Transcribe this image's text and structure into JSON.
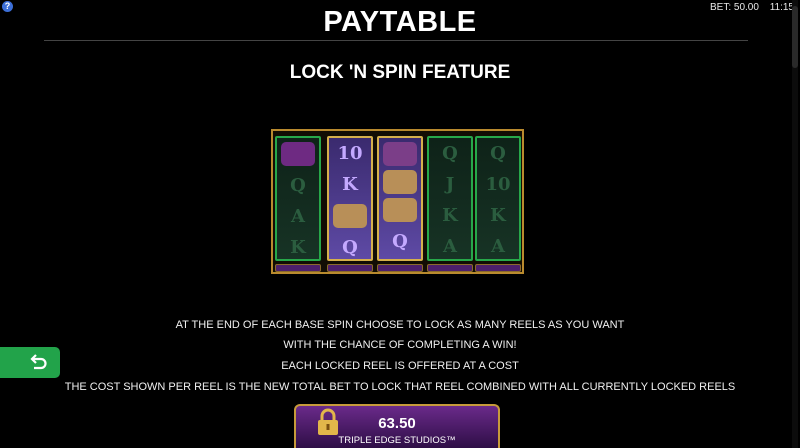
{
  "status": {
    "bet": "BET: 50.00",
    "time": "11:15"
  },
  "help_label": "?",
  "header": {
    "title": "PAYTABLE",
    "subtitle": "LOCK 'N SPIN FEATURE"
  },
  "reels": [
    {
      "state": "dim",
      "symbols": [
        "",
        "Q",
        "A",
        "K"
      ]
    },
    {
      "state": "locked",
      "symbols": [
        "10",
        "K",
        "",
        "Q"
      ]
    },
    {
      "state": "locked",
      "symbols": [
        "",
        "",
        "",
        "Q"
      ]
    },
    {
      "state": "dim",
      "symbols": [
        "Q",
        "J",
        "K",
        "A"
      ]
    },
    {
      "state": "dim",
      "symbols": [
        "Q",
        "10",
        "K",
        "A"
      ]
    }
  ],
  "description": [
    "AT THE END OF EACH BASE SPIN CHOOSE TO LOCK AS MANY REELS AS YOU WANT",
    "WITH THE CHANCE OF COMPLETING A WIN!",
    "EACH LOCKED REEL IS OFFERED AT A COST",
    "THE COST SHOWN PER REEL IS THE NEW TOTAL BET TO LOCK THAT REEL COMBINED WITH ALL CURRENTLY LOCKED REELS"
  ],
  "cost_panel": {
    "value": "63.50",
    "studio": "TRIPLE EDGE STUDIOS™"
  },
  "colors": {
    "back_button": "#22a34a",
    "reel_border_active": "#27a84a",
    "frame_gold": "#b98a2e"
  },
  "icons": {
    "back": "undo-arrow-icon",
    "help": "help-icon",
    "lock": "padlock-icon"
  }
}
